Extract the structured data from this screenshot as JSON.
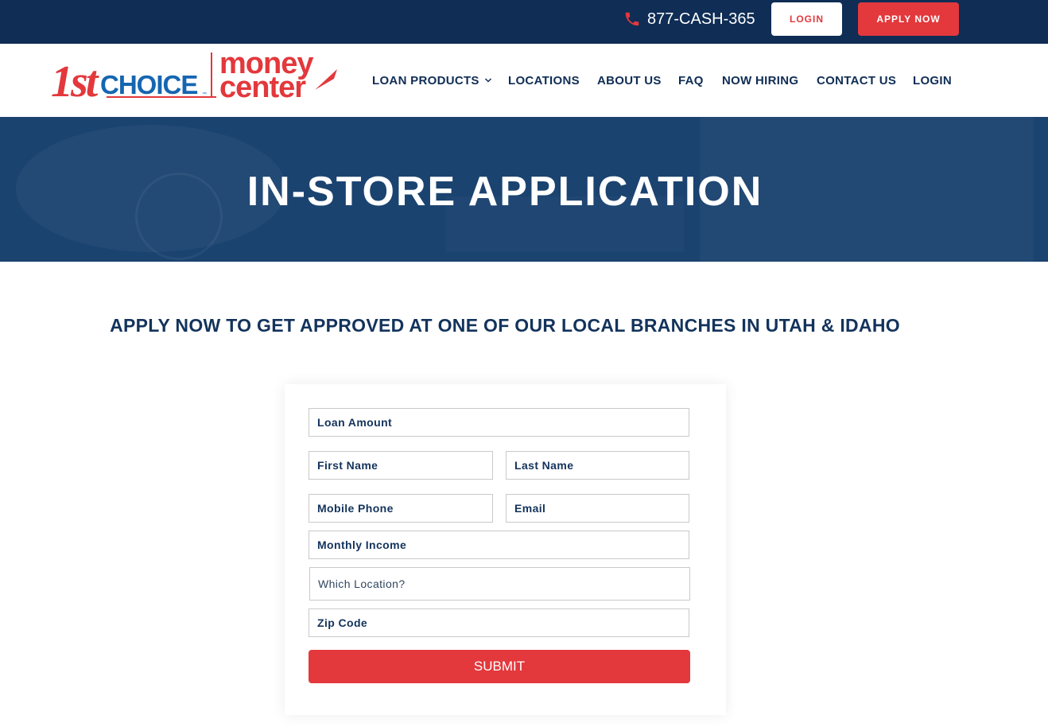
{
  "topbar": {
    "phone": "877-CASH-365",
    "login_label": "LOGIN",
    "apply_label": "APPLY NOW"
  },
  "logo": {
    "part1": "1st",
    "part2": "CHOICE",
    "part3": "money",
    "part4": "center"
  },
  "nav": {
    "items": [
      {
        "label": "LOAN PRODUCTS"
      },
      {
        "label": "LOCATIONS"
      },
      {
        "label": "ABOUT US"
      },
      {
        "label": "FAQ"
      },
      {
        "label": "NOW HIRING"
      },
      {
        "label": "CONTACT US"
      },
      {
        "label": "LOGIN"
      }
    ]
  },
  "hero": {
    "title": "IN-STORE APPLICATION"
  },
  "main": {
    "subheading": "APPLY NOW TO GET APPROVED AT ONE OF OUR LOCAL BRANCHES IN UTAH & IDAHO"
  },
  "form": {
    "loan_amount": "Loan Amount",
    "first_name": "First Name",
    "last_name": "Last Name",
    "mobile_phone": "Mobile Phone",
    "email": "Email",
    "monthly_income": "Monthly Income",
    "location": "Which Location?",
    "zip": "Zip Code",
    "submit_label": "SUBMIT"
  },
  "colors": {
    "navy": "#0f2d55",
    "hero_blue": "#1b4370",
    "brand_red": "#e3383c",
    "brand_blue": "#1566b1"
  },
  "icons": {
    "phone": "phone-icon",
    "dropdown": "chevron-down-icon"
  }
}
